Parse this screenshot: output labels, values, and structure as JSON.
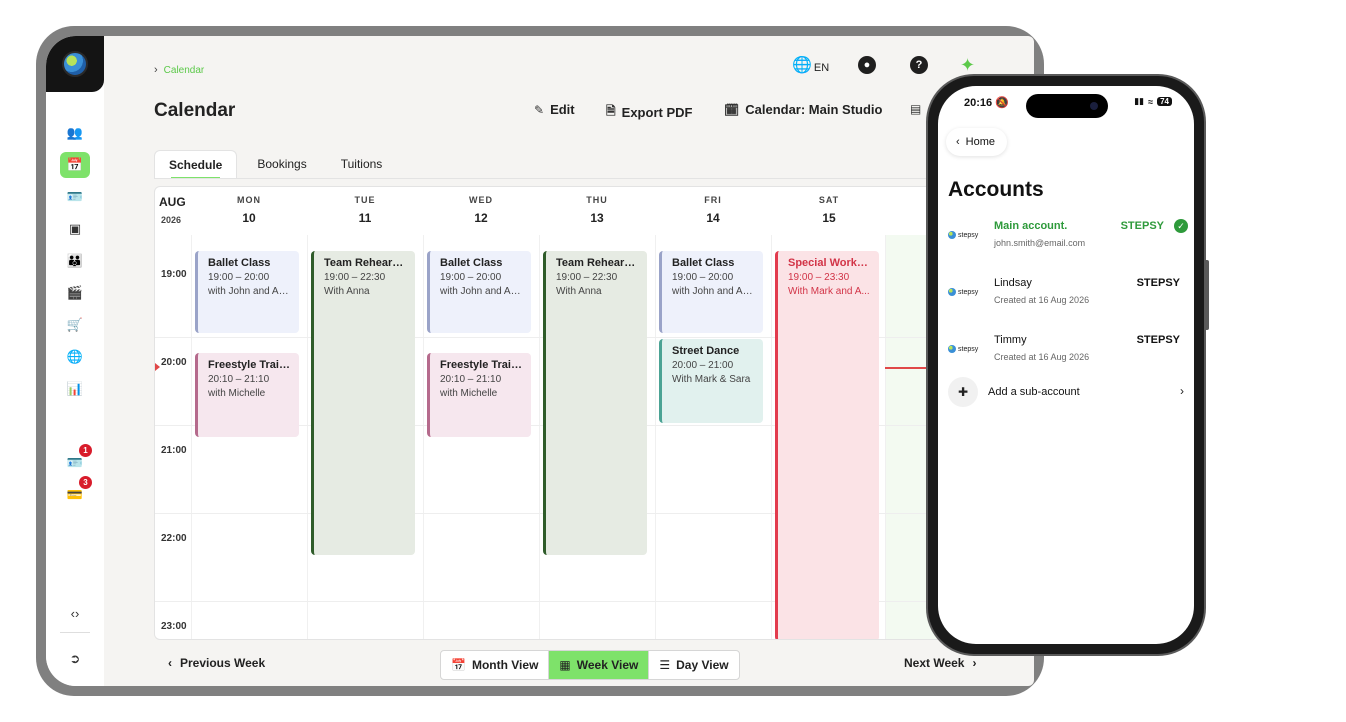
{
  "breadcrumb": {
    "label": "Calendar"
  },
  "header": {
    "lang": "EN",
    "title": "Calendar",
    "edit_label": "Edit",
    "export_label": "Export PDF",
    "calendar_label": "Calendar: Main Studio"
  },
  "tabs": [
    {
      "label": "Schedule",
      "active": true
    },
    {
      "label": "Bookings",
      "active": false
    },
    {
      "label": "Tuitions",
      "active": false
    }
  ],
  "sidebar": {
    "badges": {
      "contacts": "1",
      "payments": "3"
    },
    "active_item": "calendar"
  },
  "calendar": {
    "month": "AUG",
    "year": "2026",
    "days": [
      {
        "name": "MON",
        "num": "10"
      },
      {
        "name": "TUE",
        "num": "11"
      },
      {
        "name": "WED",
        "num": "12"
      },
      {
        "name": "THU",
        "num": "13"
      },
      {
        "name": "FRI",
        "num": "14"
      },
      {
        "name": "SAT",
        "num": "15"
      }
    ],
    "times": [
      "19:00",
      "20:00",
      "21:00",
      "22:00",
      "23:00"
    ],
    "events": [
      {
        "title": "Ballet Class",
        "time": "19:00 – 20:00",
        "with": "with John and An...",
        "color": "#9aa3c8"
      },
      {
        "title": "Freestyle Train...",
        "time": "20:10 – 21:10",
        "with": "with Michelle",
        "color": "#b56a8c"
      },
      {
        "title": "Team Rehears...",
        "time": "19:00 – 22:30",
        "with": "With Anna",
        "color": "#2f5c2a"
      },
      {
        "title": "Ballet Class",
        "time": "19:00 – 20:00",
        "with": "with John and An...",
        "color": "#9aa3c8"
      },
      {
        "title": "Freestyle Train...",
        "time": "20:10 – 21:10",
        "with": "with Michelle",
        "color": "#b56a8c"
      },
      {
        "title": "Team Rehears...",
        "time": "19:00 – 22:30",
        "with": "With Anna",
        "color": "#2f5c2a"
      },
      {
        "title": "Ballet Class",
        "time": "19:00 – 20:00",
        "with": "with John and An...",
        "color": "#9aa3c8"
      },
      {
        "title": "Street Dance",
        "time": "20:00 – 21:00",
        "with": "With Mark & Sara",
        "color": "#4ba394"
      },
      {
        "title": "Special Works...",
        "time": "19:00 – 23:30",
        "with": "With Mark and A...",
        "color": "#e23b4d"
      }
    ]
  },
  "footer": {
    "prev_label": "Previous Week",
    "next_label": "Next Week",
    "views": [
      {
        "label": "Month View",
        "active": false
      },
      {
        "label": "Week View",
        "active": true
      },
      {
        "label": "Day View",
        "active": false
      }
    ]
  },
  "phone": {
    "status_time": "20:16",
    "battery": "74",
    "back_label": "Home",
    "title": "Accounts",
    "accounts": [
      {
        "name": "Main account.",
        "sub": "john.smith@email.com",
        "brand": "STEPSY",
        "main": true
      },
      {
        "name": "Lindsay",
        "sub": "Created at 16 Aug 2026",
        "brand": "STEPSY",
        "main": false
      },
      {
        "name": "Timmy",
        "sub": "Created at 16 Aug 2026",
        "brand": "STEPSY",
        "main": false
      }
    ],
    "logo_text": "stepsy",
    "add_label": "Add a sub-account"
  },
  "colors": {
    "accent": "#7ee26a",
    "main_account": "#2e9a3b",
    "badge": "#d81c2b",
    "now_line": "#e04848"
  }
}
